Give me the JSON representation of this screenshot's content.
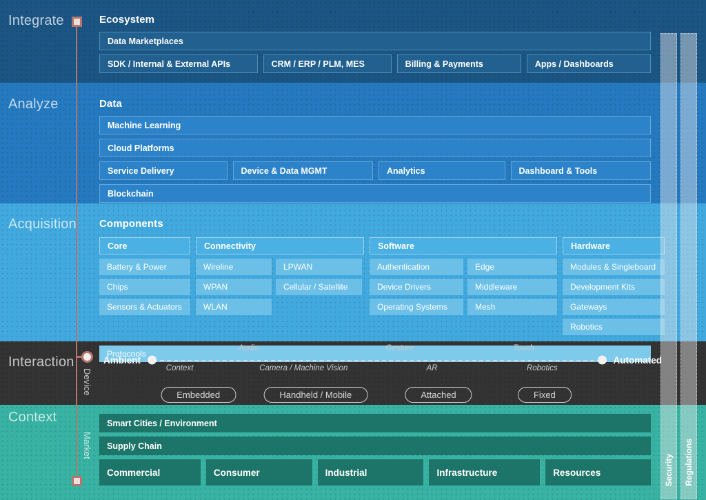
{
  "stages": [
    {
      "label": "Integrate"
    },
    {
      "label": "Analyze"
    },
    {
      "label": "Acquisition"
    },
    {
      "label": "Interaction"
    },
    {
      "label": "Context"
    }
  ],
  "timeline": {
    "device_label": "Device",
    "market_label": "Market",
    "line_color": "#b5756c"
  },
  "integrate": {
    "group_title": "Ecosystem",
    "wide": "Data Marketplaces",
    "items": [
      "SDK / Internal & External APIs",
      "CRM / ERP / PLM, MES",
      "Billing & Payments",
      "Apps / Dashboards"
    ]
  },
  "analyze": {
    "group_title": "Data",
    "wide1": "Machine Learning",
    "wide2": "Cloud Platforms",
    "items": [
      "Service Delivery",
      "Device & Data MGMT",
      "Analytics",
      "Dashboard & Tools"
    ],
    "wide3": "Blockchain"
  },
  "acquisition": {
    "group_title": "Components",
    "columns": [
      {
        "header": "Core",
        "subcolumns": [
          [
            "Battery & Power",
            "Chips",
            "Sensors & Actuators"
          ]
        ]
      },
      {
        "header": "Connectivity",
        "subcolumns": [
          [
            "Wireline",
            "WPAN",
            "WLAN"
          ],
          [
            "LPWAN",
            "Cellular / Satellite"
          ]
        ]
      },
      {
        "header": "Software",
        "subcolumns": [
          [
            "Authentication",
            "Device Drivers",
            "Operating Systems"
          ],
          [
            "Edge",
            "Middleware",
            "Mesh"
          ]
        ]
      },
      {
        "header": "Hardware",
        "subcolumns": [
          [
            "Modules & Singleboard",
            "Development Kits",
            "Gateways",
            "Robotics"
          ]
        ]
      }
    ],
    "footer": "Protocools"
  },
  "interaction": {
    "left_label": "Ambient",
    "right_label": "Automated",
    "ticks_top": [
      "Audio",
      "Gesture",
      "Touch"
    ],
    "ticks_bottom": [
      "Context",
      "Camera / Machine Vision",
      "AR",
      "Robotics"
    ],
    "chips": [
      "Embedded",
      "Handheld / Mobile",
      "Attached",
      "Fixed"
    ]
  },
  "context": {
    "wide1": "Smart Cities / Environment",
    "wide2": "Supply Chain",
    "items": [
      "Commercial",
      "Consumer",
      "Industrial",
      "Infrastructure",
      "Resources"
    ]
  },
  "overlays": [
    {
      "label": "Security"
    },
    {
      "label": "Regulations"
    }
  ],
  "colors": {
    "integrate_bg": "#1b5584",
    "analyze_bg": "#2579bf",
    "acquisition_bg": "#42a9df",
    "interaction_bg": "#333333",
    "context_bg": "#38b2a3",
    "context_box": "#1d7468",
    "timeline": "#b5756c"
  }
}
